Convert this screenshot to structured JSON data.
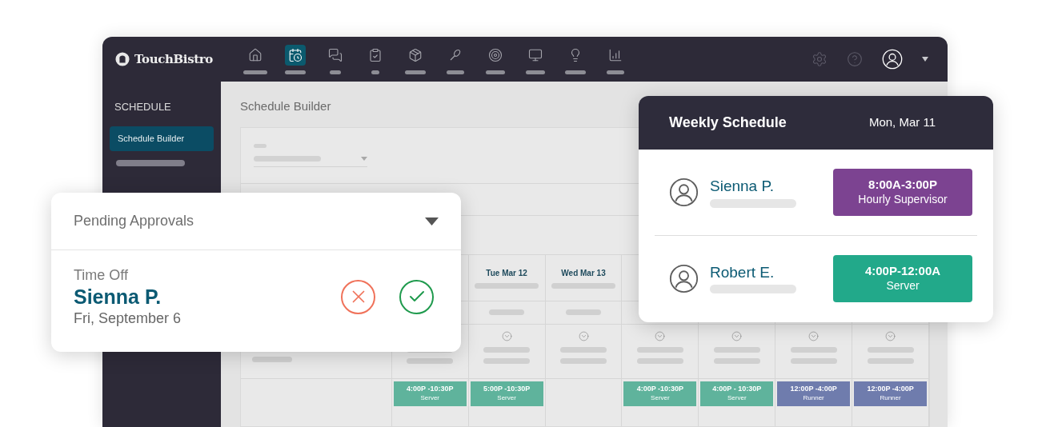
{
  "app": {
    "logo": "TouchBistro"
  },
  "nav": [
    {
      "selected": false
    },
    {
      "selected": true
    },
    {
      "selected": false
    },
    {
      "selected": false
    },
    {
      "selected": false
    },
    {
      "selected": false
    },
    {
      "selected": false
    },
    {
      "selected": false
    },
    {
      "selected": false
    },
    {
      "selected": false
    }
  ],
  "sidebar": {
    "title": "SCHEDULE",
    "items": [
      {
        "label": "Schedule Builder",
        "selected": true
      }
    ]
  },
  "page": {
    "title": "Schedule Builder"
  },
  "schedule": {
    "columns": [
      {
        "shift": {
          "time": "4:00P -10:30P",
          "role": "Server",
          "color": "#5fb39c"
        }
      },
      {
        "label": "Tue Mar 12",
        "shift": {
          "time": "5:00P -10:30P",
          "role": "Server",
          "color": "#5fb39c"
        }
      },
      {
        "label": "Wed Mar 13"
      },
      {
        "shift": {
          "time": "4:00P -10:30P",
          "role": "Server",
          "color": "#5fb39c"
        }
      },
      {
        "shift": {
          "time": "4:00P - 10:30P",
          "role": "Server",
          "color": "#5fb39c"
        }
      },
      {
        "shift": {
          "time": "12:00P -4:00P",
          "role": "Runner",
          "color": "#6f7cad"
        }
      },
      {
        "shift": {
          "time": "12:00P -4:00P",
          "role": "Runner",
          "color": "#6f7cad"
        }
      }
    ]
  },
  "pending": {
    "title": "Pending Approvals",
    "request": {
      "type": "Time Off",
      "name": "Sienna P.",
      "date": "Fri, September 6"
    }
  },
  "weekly": {
    "title": "Weekly Schedule",
    "date": "Mon, Mar 11",
    "entries": [
      {
        "name": "Sienna P.",
        "time": "8:00A-3:00P",
        "role": "Hourly Supervisor",
        "color": "#7c4391"
      },
      {
        "name": "Robert E.",
        "time": "4:00P-12:00A",
        "role": "Server",
        "color": "#22a98a"
      }
    ]
  }
}
